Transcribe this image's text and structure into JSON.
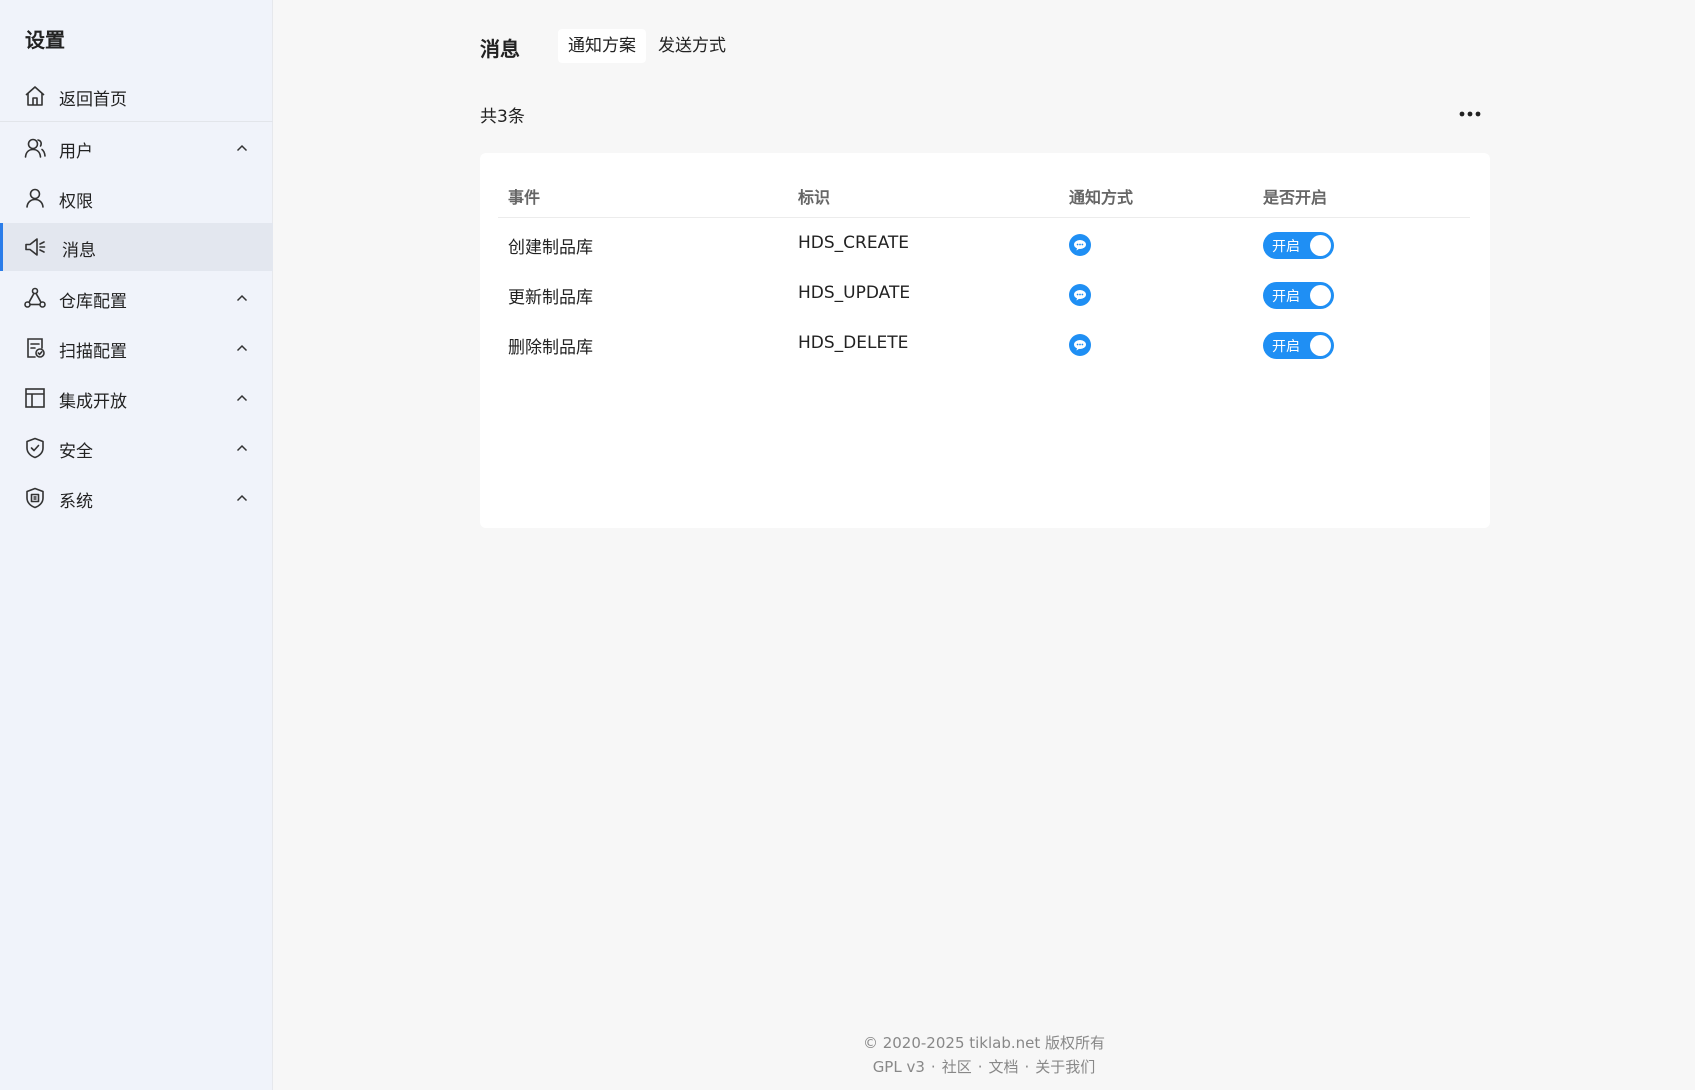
{
  "sidebar": {
    "title": "设置",
    "items": [
      {
        "label": "返回首页",
        "icon": "home-icon",
        "has_chevron": false
      },
      {
        "label": "用户",
        "icon": "users-icon",
        "has_chevron": true
      },
      {
        "label": "权限",
        "icon": "user-icon",
        "has_chevron": false
      },
      {
        "label": "消息",
        "icon": "megaphone-icon",
        "has_chevron": false,
        "active": true
      },
      {
        "label": "仓库配置",
        "icon": "network-icon",
        "has_chevron": true
      },
      {
        "label": "扫描配置",
        "icon": "scan-doc-icon",
        "has_chevron": true
      },
      {
        "label": "集成开放",
        "icon": "layout-icon",
        "has_chevron": true
      },
      {
        "label": "安全",
        "icon": "shield-check-icon",
        "has_chevron": true
      },
      {
        "label": "系统",
        "icon": "system-shield-icon",
        "has_chevron": true
      }
    ]
  },
  "main": {
    "title": "消息",
    "tabs": [
      {
        "label": "通知方案",
        "active": true
      },
      {
        "label": "发送方式",
        "active": false
      }
    ],
    "count_text": "共3条",
    "more_icon": "more-horizontal-icon",
    "table": {
      "headers": [
        "事件",
        "标识",
        "通知方式",
        "是否开启"
      ],
      "rows": [
        {
          "event": "创建制品库",
          "key": "HDS_CREATE",
          "notify_icon": "message-bubble-icon",
          "enabled_label": "开启",
          "enabled": true
        },
        {
          "event": "更新制品库",
          "key": "HDS_UPDATE",
          "notify_icon": "message-bubble-icon",
          "enabled_label": "开启",
          "enabled": true
        },
        {
          "event": "删除制品库",
          "key": "HDS_DELETE",
          "notify_icon": "message-bubble-icon",
          "enabled_label": "开启",
          "enabled": true
        }
      ]
    }
  },
  "footer": {
    "copyright": "© 2020-2025 tiklab.net 版权所有",
    "links": [
      "GPL v3",
      "社区",
      "文档",
      "关于我们"
    ]
  },
  "colors": {
    "accent": "#1f8ff4",
    "sidebar_bg": "#f0f3fa",
    "active_item_bg": "#e3e7ef",
    "page_bg": "#f7f7f7"
  }
}
